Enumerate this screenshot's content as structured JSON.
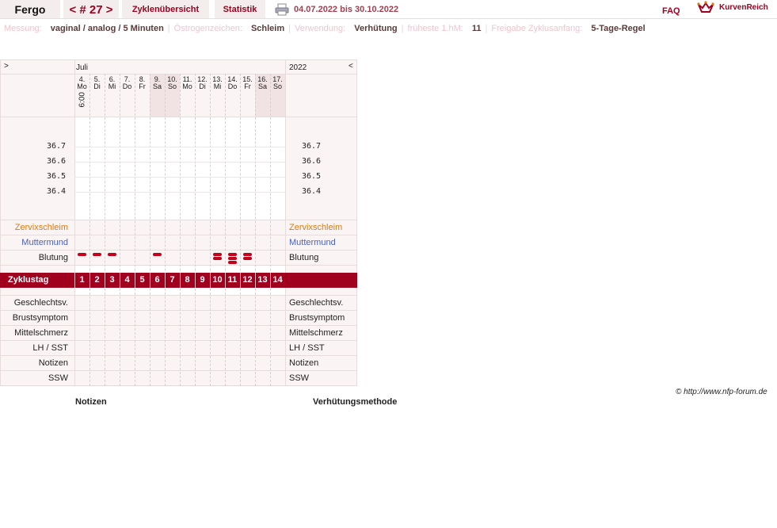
{
  "header": {
    "user": "Fergo",
    "cycle_nav": "< # 27 >",
    "tabs": [
      {
        "label": "Zyklenübersicht"
      },
      {
        "label": "Statistik"
      }
    ],
    "date_range": "04.07.2022 bis 30.10.2022",
    "faq": "FAQ",
    "logo": "KurvenReich",
    "accent_color": "#a0001e"
  },
  "info": {
    "measure_label": "Messung:",
    "measure_value": "vaginal / analog / 5 Minuten",
    "estrogen_label": "Östrogenzeichen:",
    "estrogen_value": "Schleim",
    "use_label": "Verwendung:",
    "use_value": "Verhütung",
    "earliest_label": "früheste 1.hM:",
    "earliest_value": "11",
    "release_label": "Freigabe Zyklusanfang:",
    "release_value": "5-Tage-Regel"
  },
  "chart": {
    "nav_left": ">",
    "nav_right": "<",
    "month": "Juli",
    "year": "2022",
    "time": "6:00",
    "days": [
      {
        "num": "4.",
        "wd": "Mo",
        "weekend": false
      },
      {
        "num": "5.",
        "wd": "Di",
        "weekend": false
      },
      {
        "num": "6.",
        "wd": "Mi",
        "weekend": false
      },
      {
        "num": "7.",
        "wd": "Do",
        "weekend": false
      },
      {
        "num": "8.",
        "wd": "Fr",
        "weekend": false
      },
      {
        "num": "9.",
        "wd": "Sa",
        "weekend": true
      },
      {
        "num": "10.",
        "wd": "So",
        "weekend": true
      },
      {
        "num": "11.",
        "wd": "Mo",
        "weekend": false
      },
      {
        "num": "12.",
        "wd": "Di",
        "weekend": false
      },
      {
        "num": "13.",
        "wd": "Mi",
        "weekend": false
      },
      {
        "num": "14.",
        "wd": "Do",
        "weekend": false
      },
      {
        "num": "15.",
        "wd": "Fr",
        "weekend": false
      },
      {
        "num": "16.",
        "wd": "Sa",
        "weekend": true
      },
      {
        "num": "17.",
        "wd": "So",
        "weekend": true
      }
    ],
    "temperatures": [
      "36.7",
      "36.6",
      "36.5",
      "36.4"
    ],
    "rows": {
      "mucus": "Zervixschleim",
      "cervix": "Muttermund",
      "bleeding": "Blutung",
      "cycle_day": "Zyklustag",
      "intercourse": "Geschlechtsv.",
      "breast": "Brustsymptom",
      "midpain": "Mittelschmerz",
      "lh": "LH / SST",
      "notes": "Notizen",
      "ssw": "SSW"
    },
    "bleeding_levels": [
      1,
      1,
      1,
      0,
      0,
      1,
      0,
      0,
      0,
      2,
      3,
      2,
      0,
      0
    ],
    "cycle_days": [
      "1",
      "2",
      "3",
      "4",
      "5",
      "6",
      "7",
      "8",
      "9",
      "10",
      "11",
      "12",
      "13",
      "14"
    ],
    "mucus_color": "#e07a10",
    "cervix_color": "#4a5fc0",
    "bleeding_color": "#c4001a"
  },
  "footer": {
    "copyright": "© http://www.nfp-forum.de",
    "notes_title": "Notizen",
    "method_title": "Verhütungsmethode"
  }
}
